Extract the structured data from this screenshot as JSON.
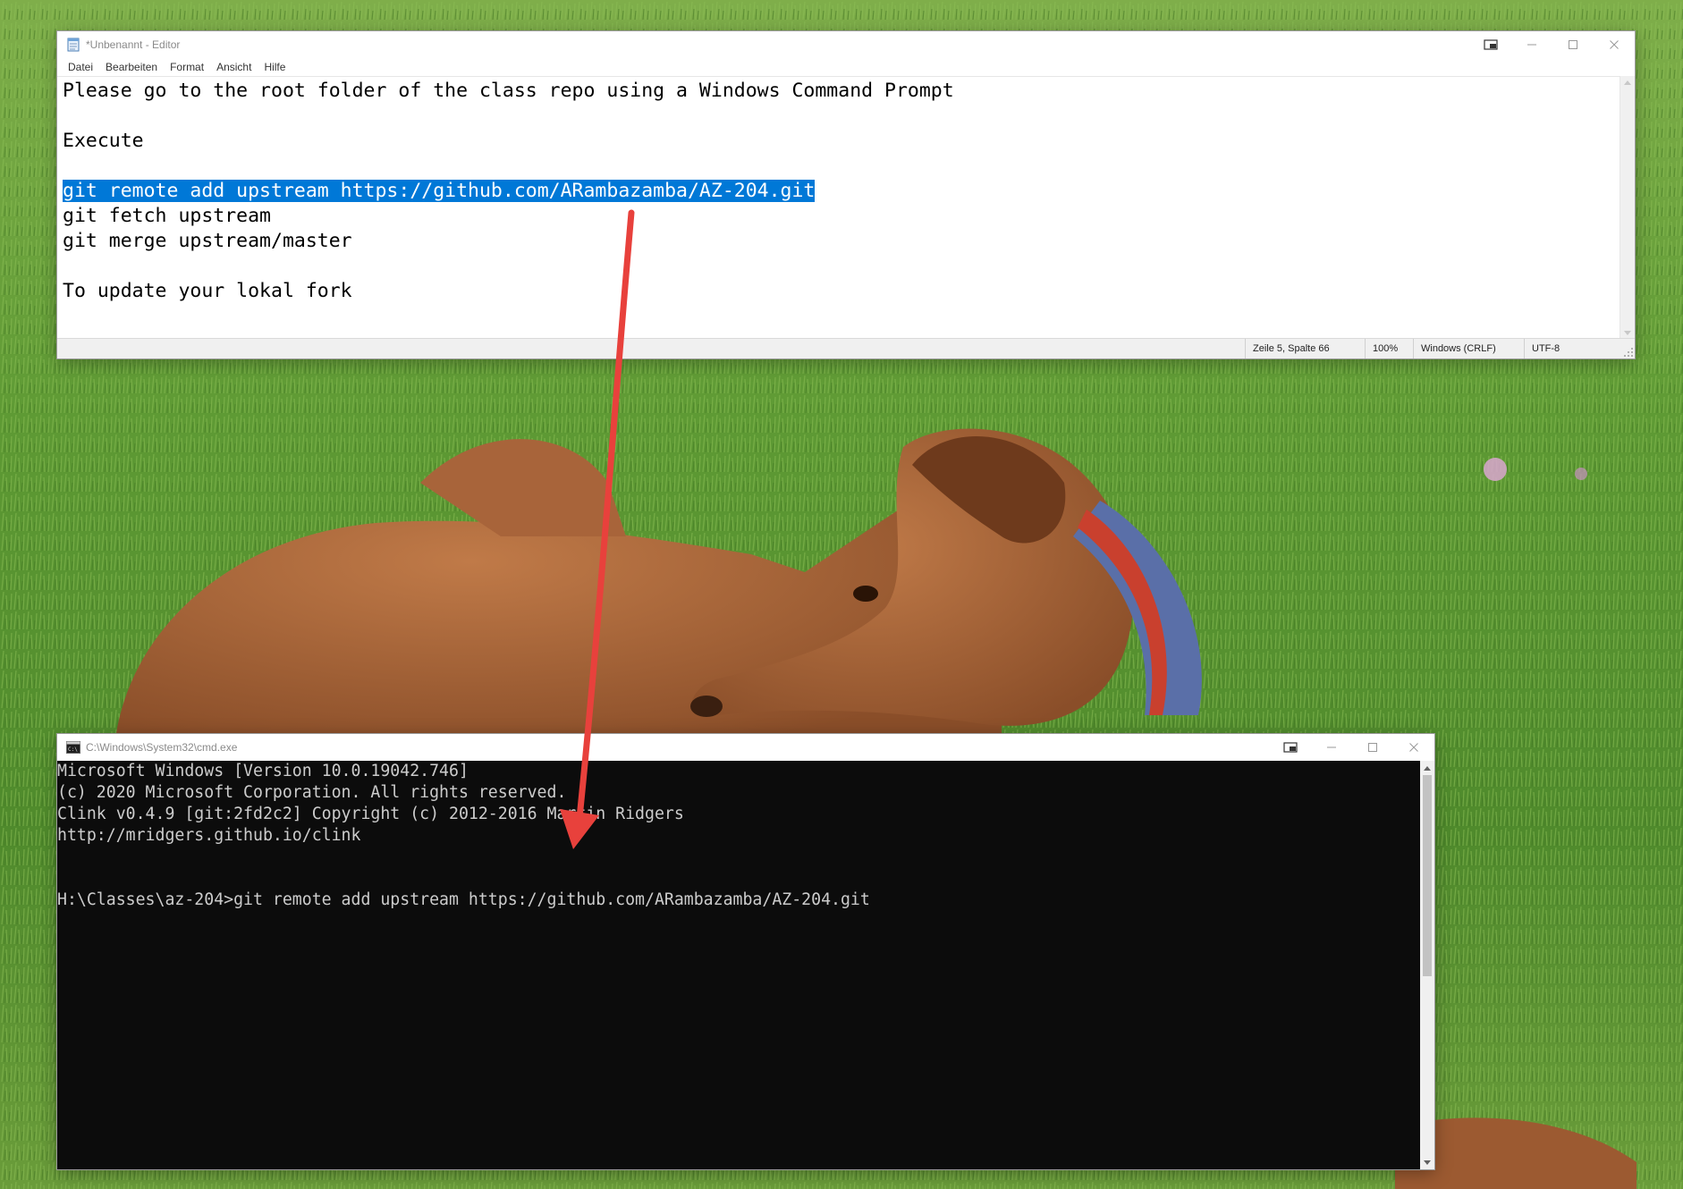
{
  "notepad": {
    "title": "*Unbenannt - Editor",
    "menu": [
      "Datei",
      "Bearbeiten",
      "Format",
      "Ansicht",
      "Hilfe"
    ],
    "lines": [
      {
        "text": "Please go to the root folder of the class repo using a Windows Command Prompt",
        "selected": false
      },
      {
        "text": "",
        "selected": false
      },
      {
        "text": "Execute",
        "selected": false
      },
      {
        "text": "",
        "selected": false
      },
      {
        "text": "git remote add upstream https://github.com/ARambazamba/AZ-204.git",
        "selected": true
      },
      {
        "text": "git fetch upstream",
        "selected": false
      },
      {
        "text": "git merge upstream/master",
        "selected": false
      },
      {
        "text": "",
        "selected": false
      },
      {
        "text": "To update your lokal fork",
        "selected": false
      }
    ],
    "status": {
      "position": "Zeile 5, Spalte 66",
      "zoom": "100%",
      "line_ending": "Windows (CRLF)",
      "encoding": "UTF-8"
    }
  },
  "cmd": {
    "title": "C:\\Windows\\System32\\cmd.exe",
    "lines": [
      "Microsoft Windows [Version 10.0.19042.746]",
      "(c) 2020 Microsoft Corporation. All rights reserved.",
      "Clink v0.4.9 [git:2fd2c2] Copyright (c) 2012-2016 Martin Ridgers",
      "http://mridgers.github.io/clink",
      "",
      "",
      "H:\\Classes\\az-204>git remote add upstream https://github.com/ARambazamba/AZ-204.git"
    ]
  },
  "colors": {
    "selection": "#0078d7",
    "console_bg": "#0c0c0c",
    "console_fg": "#cccccc",
    "annotation_arrow": "#e8413c"
  },
  "icons": {
    "notepad_app": "notepad-icon",
    "cmd_app": "cmd-icon",
    "compact_overlay": "compact-overlay-icon",
    "minimize": "minimize-icon",
    "maximize": "maximize-icon",
    "close": "close-icon"
  }
}
